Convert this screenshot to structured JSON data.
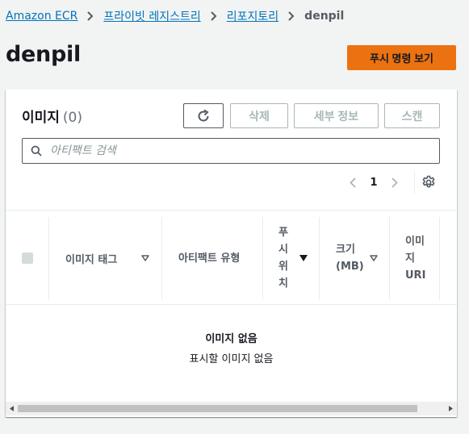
{
  "breadcrumb": {
    "items": [
      "Amazon ECR",
      "프라이빗 레지스트리",
      "리포지토리"
    ],
    "current": "denpil"
  },
  "header": {
    "title": "denpil",
    "push_button_label": "푸시 명령 보기"
  },
  "images_panel": {
    "title": "이미지",
    "count": "(0)",
    "buttons": {
      "delete": "삭제",
      "details": "세부 정보",
      "scan": "스캔"
    },
    "search": {
      "placeholder": "아티팩트 검색",
      "value": ""
    },
    "pagination": {
      "current_page": "1"
    },
    "columns": [
      "이미지 태그",
      "아티팩트 유형",
      "푸시 위치",
      "크기 (MB)",
      "이미지 URI"
    ],
    "empty_state": {
      "title": "이미지 없음",
      "subtitle": "표시할 이미지 없음"
    }
  },
  "icons": {
    "breadcrumb_separator": "chevron-right-icon",
    "refresh": "refresh-icon",
    "search": "search-icon",
    "prev": "chevron-left-icon",
    "next": "chevron-right-icon",
    "settings": "gear-icon",
    "sort": "caret-down-icon"
  },
  "colors": {
    "accent": "#ec7211",
    "link": "#0073bb",
    "page_background": "#f2f3f3"
  }
}
